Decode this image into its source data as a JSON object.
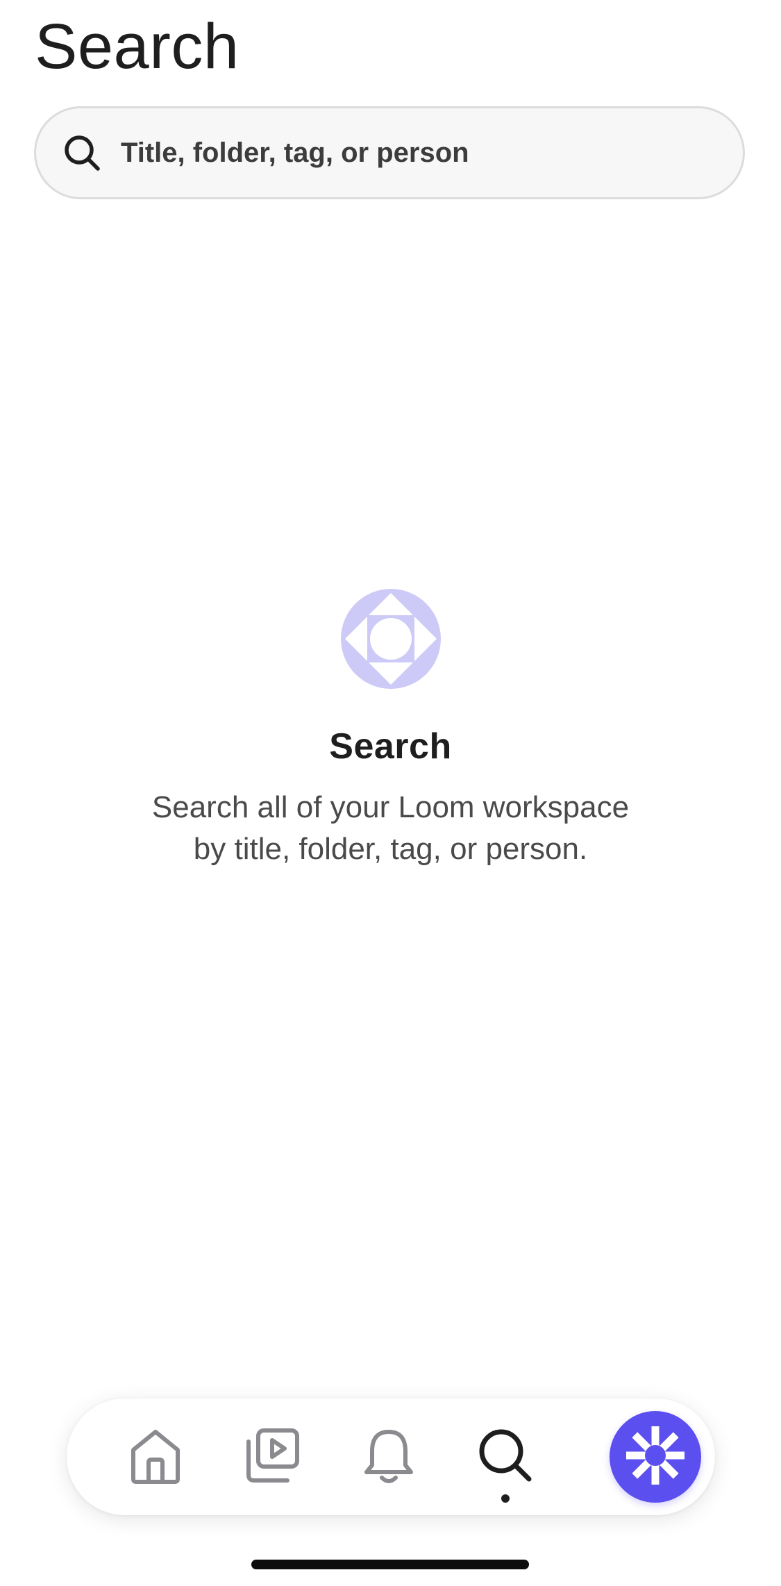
{
  "header": {
    "title": "Search"
  },
  "search": {
    "placeholder": "Title, folder, tag, or person",
    "value": "",
    "icon": "search-icon"
  },
  "empty_state": {
    "icon": "loom-search-emblem-icon",
    "title": "Search",
    "description": "Search all of your Loom workspace by title, folder, tag, or person."
  },
  "tab_bar": {
    "items": [
      {
        "id": "home",
        "icon": "home-icon",
        "active": false
      },
      {
        "id": "library",
        "icon": "video-library-icon",
        "active": false
      },
      {
        "id": "notifications",
        "icon": "bell-icon",
        "active": false
      },
      {
        "id": "search",
        "icon": "search-icon",
        "active": true
      }
    ],
    "record": {
      "icon": "loom-record-icon"
    }
  },
  "colors": {
    "accent": "#5b4ff0",
    "emblem": "#cdcaf7",
    "inactive_icon": "#8a8a8f",
    "active_icon": "#1e1e1e"
  }
}
